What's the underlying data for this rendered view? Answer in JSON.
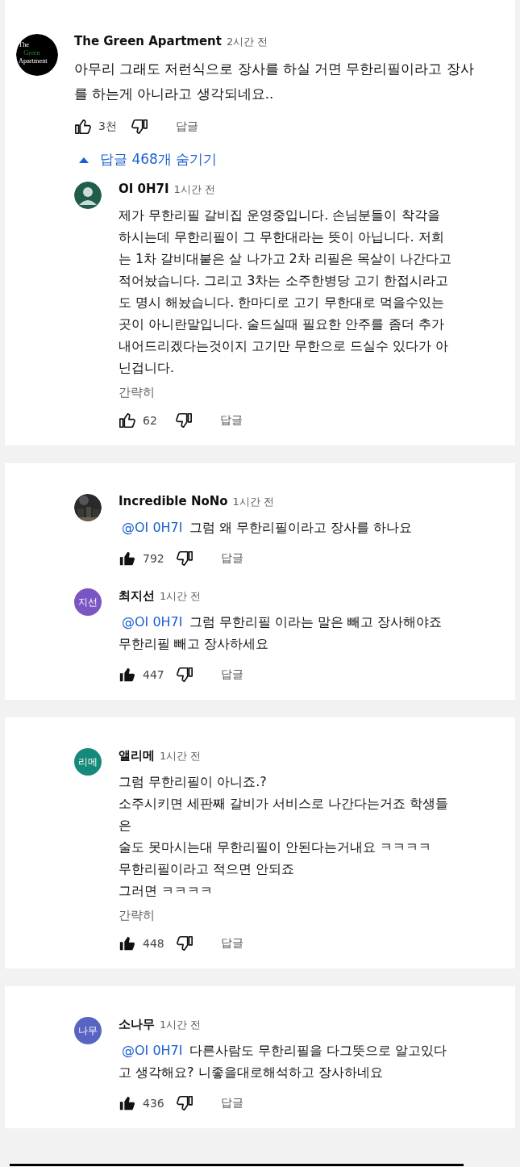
{
  "cards": [
    {
      "comments": [
        {
          "kind": "top",
          "avatar": {
            "kind": "logo",
            "lines": [
              "The",
              "Green",
              "Apartment"
            ]
          },
          "author": "The Green Apartment",
          "time": "2시간 전",
          "body": "아무리 그래도 저런식으로 장사를 하실 거면 무한리필이라고 장사\n를 하는게 아니라고 생각되네요..",
          "likes": "3천",
          "liked": false,
          "reply_label": "답글",
          "replies_toggle": {
            "label": "답글 468개 숨기기",
            "expanded": true
          },
          "children": [
            {
              "kind": "reply",
              "avatar": {
                "kind": "silhouette",
                "color": "#1f5c4c"
              },
              "author": "OI 0H7I",
              "time": "1시간 전",
              "body": "제가 무한리필 갈비집 운영중입니다. 손님분들이 착각을\n하시는데 무한리필이 그 무한대라는 뜻이 아닙니다. 저희\n는 1차 갈비대붙은 살 나가고 2차 리필은 목살이 나간다고\n적어놨습니다. 그리고 3차는 소주한병당 고기 한접시라고\n도 명시 해놨습니다. 한마디로 고기 무한대로 먹을수있는\n곳이 아니란말입니다. 술드실때 필요한 안주를 좀더 추가\n내어드리겠다는것이지 고기만 무한으로 드실수 있다가 아\n닌겁니다.",
              "collapse_label": "간략히",
              "likes": "62",
              "liked": false,
              "reply_label": "답글"
            }
          ]
        }
      ]
    },
    {
      "comments": [
        {
          "kind": "reply",
          "author": "Incredible NoNo",
          "time": "1시간 전",
          "mention": "@OI 0H7I",
          "body": "그럼 왜 무한리필이라고 장사를 하나요",
          "likes": "792",
          "liked": true,
          "reply_label": "답글"
        },
        {
          "kind": "reply",
          "avatar": {
            "kind": "initials",
            "text": "지선",
            "color": "#7b55c4"
          },
          "author": "최지선",
          "time": "1시간 전",
          "mention": "@OI 0H7I",
          "body": "그럼 무한리필 이라는 말은 빼고 장사해야죠\n무한리필 빼고 장사하세요",
          "likes": "447",
          "liked": true,
          "reply_label": "답글"
        }
      ]
    },
    {
      "comments": [
        {
          "kind": "reply",
          "avatar": {
            "kind": "initials",
            "text": "리메",
            "color": "#15897a"
          },
          "author": "앨리메",
          "time": "1시간 전",
          "body": "그럼 무한리필이 아니죠.?\n소주시키면 세판째 갈비가 서비스로 나간다는거죠 학생들\n은\n술도 못마시는대 무한리필이 안된다는거내요 ㅋㅋㅋㅋ\n무한리필이라고 적으면 안되죠\n그러면 ㅋㅋㅋㅋ",
          "collapse_label": "간략히",
          "likes": "448",
          "liked": true,
          "reply_label": "답글"
        }
      ]
    },
    {
      "comments": [
        {
          "kind": "reply",
          "avatar": {
            "kind": "initials",
            "text": "나무",
            "color": "#5864c4"
          },
          "author": "소나무",
          "time": "1시간 전",
          "mention": "@OI 0H7I",
          "body": "다른사람도 무한리필을 다그뜻으로 알고있다\n고 생각해요? 니좋을대로해석하고 장사하네요",
          "likes": "436",
          "liked": true,
          "reply_label": "답글"
        }
      ]
    }
  ]
}
